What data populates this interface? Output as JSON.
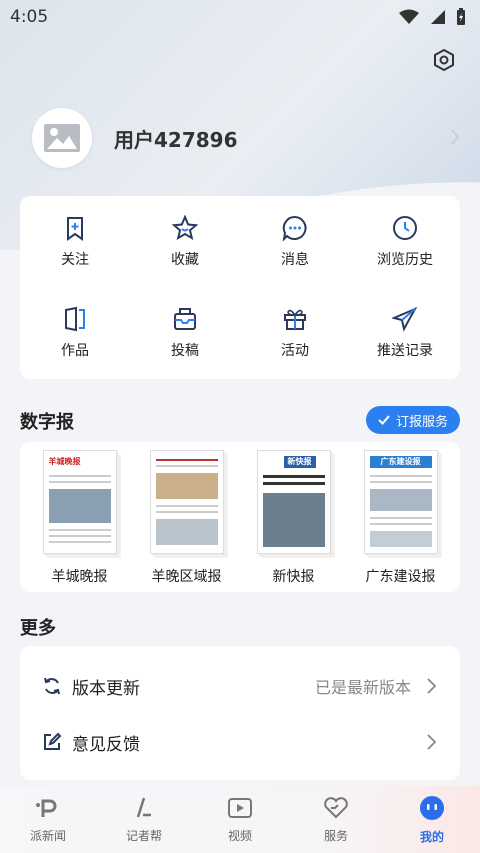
{
  "status_bar": {
    "time": "4:05"
  },
  "profile": {
    "username": "用户427896"
  },
  "quick_actions": [
    {
      "label": "关注",
      "icon": "bookmark-add-icon"
    },
    {
      "label": "收藏",
      "icon": "star-icon"
    },
    {
      "label": "消息",
      "icon": "message-icon"
    },
    {
      "label": "浏览历史",
      "icon": "clock-icon"
    },
    {
      "label": "作品",
      "icon": "works-icon"
    },
    {
      "label": "投稿",
      "icon": "inbox-icon"
    },
    {
      "label": "活动",
      "icon": "gift-icon"
    },
    {
      "label": "推送记录",
      "icon": "send-icon"
    }
  ],
  "digital_paper": {
    "title": "数字报",
    "subscribe_label": "订报服务",
    "papers": [
      {
        "name": "羊城晚报",
        "masthead": "羊城晚报"
      },
      {
        "name": "羊晚区域报",
        "masthead": ""
      },
      {
        "name": "新快报",
        "masthead": "新快报"
      },
      {
        "name": "广东建设报",
        "masthead": "广东建设报"
      }
    ]
  },
  "more": {
    "title": "更多",
    "rows": [
      {
        "label": "版本更新",
        "value": "已是最新版本",
        "icon": "refresh-icon"
      },
      {
        "label": "意见反馈",
        "value": "",
        "icon": "edit-icon"
      }
    ]
  },
  "tabs": [
    {
      "label": "派新闻",
      "icon": "pai-icon",
      "active": false
    },
    {
      "label": "记者帮",
      "icon": "reporter-icon",
      "active": false
    },
    {
      "label": "视频",
      "icon": "play-icon",
      "active": false
    },
    {
      "label": "服务",
      "icon": "heart-icon",
      "active": false
    },
    {
      "label": "我的",
      "icon": "face-icon",
      "active": true
    }
  ],
  "colors": {
    "accent": "#2b6fe8",
    "icon": "#2a3a5e"
  }
}
